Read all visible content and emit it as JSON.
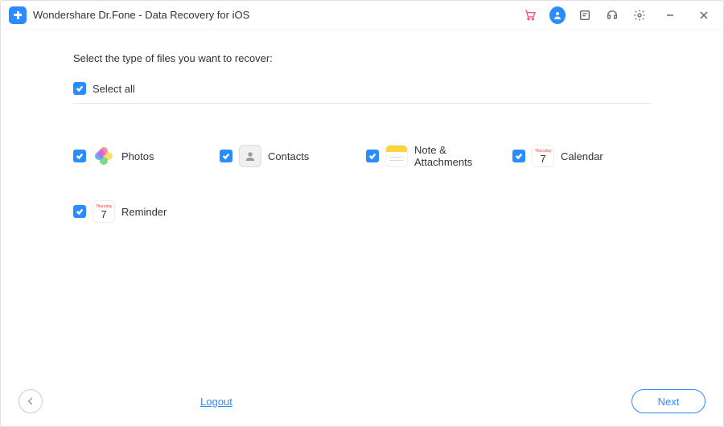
{
  "title": "Wondershare Dr.Fone - Data Recovery for iOS",
  "instruction": "Select the type of files you want to recover:",
  "select_all_label": "Select all",
  "file_types": {
    "photos": {
      "label": "Photos"
    },
    "contacts": {
      "label": "Contacts"
    },
    "notes": {
      "label": "Note & Attachments"
    },
    "calendar": {
      "label": "Calendar",
      "day_name": "Thursday",
      "day_num": "7"
    },
    "reminder": {
      "label": "Reminder",
      "day_name": "Thursday",
      "day_num": "7"
    }
  },
  "footer": {
    "logout": "Logout",
    "next": "Next"
  }
}
